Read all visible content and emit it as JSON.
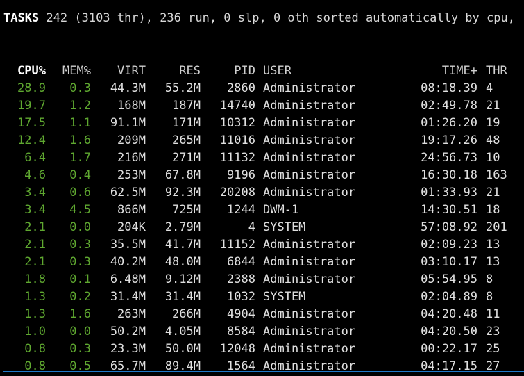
{
  "tasks": {
    "label": "TASKS",
    "summary": "242 (3103 thr), 236 run, 0 slp, 0 oth sorted automatically by cpu,"
  },
  "columns": {
    "cpu": "CPU%",
    "mem": "MEM%",
    "virt": "VIRT",
    "res": "RES",
    "pid": "PID",
    "user": "USER",
    "time": "TIME+",
    "thr": "THR"
  },
  "rows": [
    {
      "cpu": "28.9",
      "mem": "0.3",
      "virt": "44.3M",
      "res": "55.2M",
      "pid": "2860",
      "user": "Administrator",
      "time": "08:18.39",
      "thr": "4"
    },
    {
      "cpu": "19.7",
      "mem": "1.2",
      "virt": "168M",
      "res": "187M",
      "pid": "14740",
      "user": "Administrator",
      "time": "02:49.78",
      "thr": "21"
    },
    {
      "cpu": "17.5",
      "mem": "1.1",
      "virt": "91.1M",
      "res": "171M",
      "pid": "10312",
      "user": "Administrator",
      "time": "01:26.20",
      "thr": "19"
    },
    {
      "cpu": "12.4",
      "mem": "1.6",
      "virt": "209M",
      "res": "265M",
      "pid": "11016",
      "user": "Administrator",
      "time": "19:17.26",
      "thr": "48"
    },
    {
      "cpu": "6.4",
      "mem": "1.7",
      "virt": "216M",
      "res": "271M",
      "pid": "11132",
      "user": "Administrator",
      "time": "24:56.73",
      "thr": "10"
    },
    {
      "cpu": "4.6",
      "mem": "0.4",
      "virt": "253M",
      "res": "67.8M",
      "pid": "9196",
      "user": "Administrator",
      "time": "16:30.18",
      "thr": "163"
    },
    {
      "cpu": "3.4",
      "mem": "0.6",
      "virt": "62.5M",
      "res": "92.3M",
      "pid": "20208",
      "user": "Administrator",
      "time": "01:33.93",
      "thr": "21"
    },
    {
      "cpu": "3.4",
      "mem": "4.5",
      "virt": "866M",
      "res": "725M",
      "pid": "1244",
      "user": "DWM-1",
      "time": "14:30.51",
      "thr": "18"
    },
    {
      "cpu": "2.1",
      "mem": "0.0",
      "virt": "204K",
      "res": "2.79M",
      "pid": "4",
      "user": "SYSTEM",
      "time": "57:08.92",
      "thr": "201"
    },
    {
      "cpu": "2.1",
      "mem": "0.3",
      "virt": "35.5M",
      "res": "41.7M",
      "pid": "11152",
      "user": "Administrator",
      "time": "02:09.23",
      "thr": "13"
    },
    {
      "cpu": "2.1",
      "mem": "0.3",
      "virt": "40.2M",
      "res": "48.0M",
      "pid": "6844",
      "user": "Administrator",
      "time": "03:10.17",
      "thr": "13"
    },
    {
      "cpu": "1.8",
      "mem": "0.1",
      "virt": "6.48M",
      "res": "9.12M",
      "pid": "2388",
      "user": "Administrator",
      "time": "05:54.95",
      "thr": "8"
    },
    {
      "cpu": "1.3",
      "mem": "0.2",
      "virt": "31.4M",
      "res": "31.4M",
      "pid": "1032",
      "user": "SYSTEM",
      "time": "02:04.89",
      "thr": "8"
    },
    {
      "cpu": "1.3",
      "mem": "1.6",
      "virt": "263M",
      "res": "266M",
      "pid": "4904",
      "user": "Administrator",
      "time": "04:20.48",
      "thr": "11"
    },
    {
      "cpu": "1.0",
      "mem": "0.0",
      "virt": "50.2M",
      "res": "4.05M",
      "pid": "8584",
      "user": "Administrator",
      "time": "04:20.50",
      "thr": "23"
    },
    {
      "cpu": "0.8",
      "mem": "0.3",
      "virt": "23.3M",
      "res": "50.0M",
      "pid": "12048",
      "user": "Administrator",
      "time": "00:22.17",
      "thr": "25"
    },
    {
      "cpu": "0.8",
      "mem": "0.5",
      "virt": "65.7M",
      "res": "89.4M",
      "pid": "1564",
      "user": "Administrator",
      "time": "04:17.15",
      "thr": "27"
    }
  ],
  "colors": {
    "background": "#000000",
    "border": "#1e78c8",
    "percent": "#5fa830",
    "text": "#e0e0e0"
  }
}
